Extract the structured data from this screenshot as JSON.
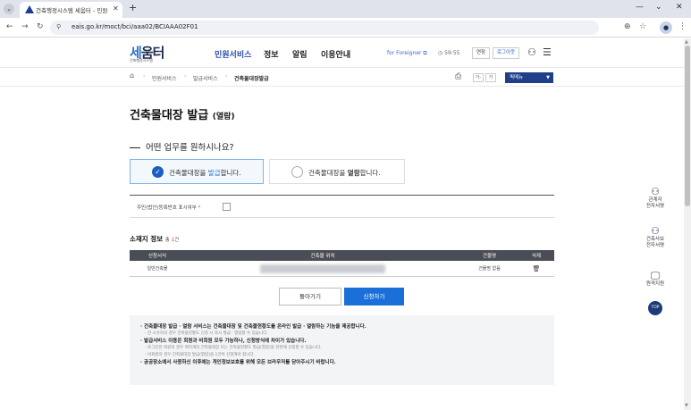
{
  "browser": {
    "tab_title": "건축행정시스템 세움터 - 민원",
    "tab_close": "✕",
    "new_tab": "+",
    "url": "eais.go.kr/moct/bci/aaa02/BCIAAA02F01",
    "window_min": "—",
    "window_max": "⌄",
    "window_close": "✕"
  },
  "site": {
    "logo_text_a": "세",
    "logo_text_b": "움터",
    "logo_sub": "건축행정시스템",
    "gnb": [
      "민원서비스",
      "정보",
      "알림",
      "이용안내"
    ],
    "foreigner": "for Foreigner ⧉",
    "timer": "59:55",
    "extend_label": "연장",
    "logout_label": "로그아웃"
  },
  "breadcrumb": {
    "items": [
      "민원서비스",
      "발급서비스",
      "건축물대장발급"
    ],
    "font_small": "가-",
    "font_large": "가",
    "quick_menu": "퀵메뉴"
  },
  "main": {
    "title": "건축물대장 발급",
    "title_suffix": "(열람)",
    "question": "어떤 업무를 원하시나요?",
    "option_issue": {
      "pre": "건축물대장을 ",
      "hl": "발급",
      "post": "합니다."
    },
    "option_view": {
      "pre": "건축물대장을 ",
      "hl": "열람",
      "post": "합니다."
    },
    "id_label": "주민(법인)등록번호 표시여부",
    "id_required": "*",
    "location_title": "소재지 정보",
    "location_count_pre": "총 ",
    "location_count_n": "1",
    "location_count_post": "건"
  },
  "table": {
    "headers": [
      "신청서식",
      "건축물 위치",
      "건물명",
      "삭제"
    ],
    "rows": [
      {
        "form": "일반건축물",
        "building_name": "건물명 없음"
      }
    ]
  },
  "buttons": {
    "back": "돌아가기",
    "apply": "신청하기"
  },
  "notice": {
    "lines": [
      {
        "text": "· 건축물대장 발급 · 열람 서비스는 건축물대장 및 건축물현황도를 온라인 발급 · 열람하는 기능을 제공합니다.",
        "sub": false
      },
      {
        "text": "- 한 소유자의 경우 건축물현황도 신청 시 즉시 발급 · 열람할 수 있습니다.",
        "sub": true
      },
      {
        "text": "· 발급서비스 이용은 회원과 비회원 모두 가능하나, 신청방식에 차이가 있습니다.",
        "sub": false
      },
      {
        "text": "- 로그인한 회원의 경우 여러개의 건축물대장 또는 건축물현황도 발급(열람)을 한번에 신청할 수 있습니다.",
        "sub": true
      },
      {
        "text": "- 비회원의 경우 건축물대장 발급(열람)을 1건씩 신청해야 합니다.",
        "sub": true
      },
      {
        "text": "· 공공장소에서 사용하신 이후에는 개인정보보호를 위해 모든 브라우저를 닫아주시기 바랍니다.",
        "sub": false
      }
    ]
  },
  "sidebar": {
    "items": [
      {
        "icon": "person-icon",
        "label1": "관계자",
        "label2": "전자서명"
      },
      {
        "icon": "person-icon",
        "label1": "건축사보",
        "label2": "전자서명"
      },
      {
        "icon": "monitor-icon",
        "label1": "원격지원",
        "label2": ""
      }
    ],
    "top": "TOP"
  }
}
